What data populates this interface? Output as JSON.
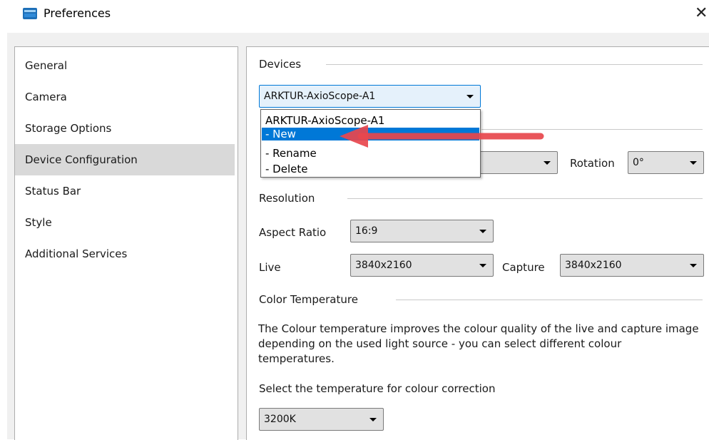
{
  "window": {
    "title": "Preferences",
    "close_symbol": "✕"
  },
  "nav": {
    "items": [
      {
        "label": "General",
        "selected": false
      },
      {
        "label": "Camera",
        "selected": false
      },
      {
        "label": "Storage Options",
        "selected": false
      },
      {
        "label": "Device Configuration",
        "selected": true
      },
      {
        "label": "Status Bar",
        "selected": false
      },
      {
        "label": "Style",
        "selected": false
      },
      {
        "label": "Additional Services",
        "selected": false
      }
    ]
  },
  "devices": {
    "section_label": "Devices",
    "selected": "ARKTUR-AxioScope-A1",
    "dropdown_open": true,
    "options": [
      "ARKTUR-AxioScope-A1",
      "- New",
      "- Rename",
      "- Delete"
    ],
    "highlighted_option": "- New"
  },
  "orientation": {
    "rotation_label": "Rotation",
    "rotation_value": "0°"
  },
  "resolution": {
    "section_label": "Resolution",
    "aspect_ratio_label": "Aspect Ratio",
    "aspect_ratio_value": "16:9",
    "live_label": "Live",
    "live_value": "3840x2160",
    "capture_label": "Capture",
    "capture_value": "3840x2160"
  },
  "color_temperature": {
    "section_label": "Color Temperature",
    "description": "The Colour temperature improves the colour quality of the live and capture image depending on the used light source -  you can select different colour temperatures.",
    "select_label": "Select the temperature for colour correction",
    "value": "3200K"
  },
  "annotation": {
    "arrow_color": "#e8474d"
  },
  "colors": {
    "accent": "#0078d7",
    "selected_nav": "#d9d9d9"
  }
}
